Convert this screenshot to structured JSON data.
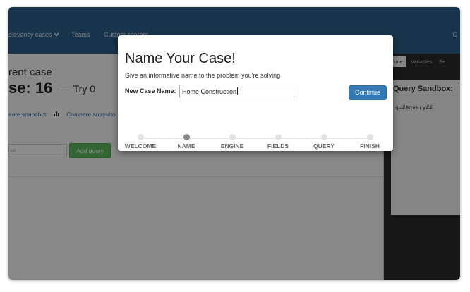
{
  "nav": {
    "relevancy_cases": "elevancy cases",
    "teams": "Teams",
    "custom_scorers": "Custom scorers",
    "right_letter": "C"
  },
  "case": {
    "subtitle": "rent case",
    "title_prefix": "se: 16",
    "try_label": "— Try 0",
    "create_snapshot": "eate snapshot",
    "compare_snapshot": "Compare snapsho",
    "query_placeholder": "se",
    "add_query_label": "Add query"
  },
  "sandbox": {
    "tabs": [
      "Tune",
      "Variables",
      "Se"
    ],
    "title": "Query Sandbox:",
    "code": "q=#$query##"
  },
  "modal": {
    "title": "Name Your Case!",
    "description": "Give an informative name to the problem you’re solving",
    "name_label": "New Case Name:",
    "name_value": "Home Construction",
    "continue_label": "Continue",
    "steps": [
      "WELCOME",
      "NAME",
      "ENGINE",
      "FIELDS",
      "QUERY",
      "FINISH"
    ],
    "active_step": "NAME"
  },
  "colors": {
    "navbar": "#2c5f8d",
    "primary_button": "#337ab7",
    "success_button": "#5cb85c"
  }
}
